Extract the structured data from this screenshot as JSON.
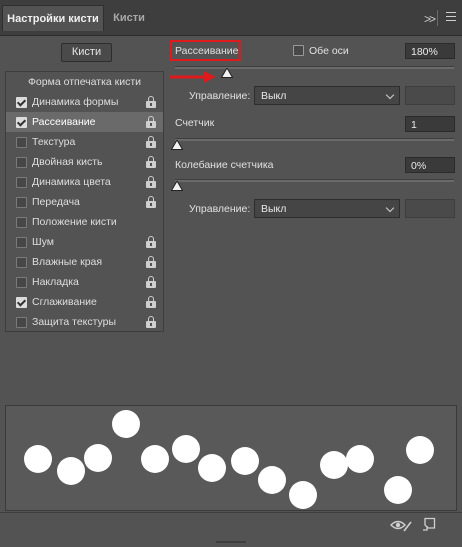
{
  "tabs": [
    {
      "label": "Настройки кисти",
      "active": true
    },
    {
      "label": "Кисти",
      "active": false
    }
  ],
  "toolbar": {
    "collapse_icon": "double-chevron-right",
    "menu_icon": "hamburger-menu"
  },
  "brushes_button": "Кисти",
  "sidebar": {
    "header": "Форма отпечатка кисти",
    "items": [
      {
        "label": "Динамика формы",
        "checked": true,
        "locked": true,
        "selected": false
      },
      {
        "label": "Рассеивание",
        "checked": true,
        "locked": true,
        "selected": true
      },
      {
        "label": "Текстура",
        "checked": false,
        "locked": true,
        "selected": false
      },
      {
        "label": "Двойная кисть",
        "checked": false,
        "locked": true,
        "selected": false
      },
      {
        "label": "Динамика цвета",
        "checked": false,
        "locked": true,
        "selected": false
      },
      {
        "label": "Передача",
        "checked": false,
        "locked": true,
        "selected": false
      },
      {
        "label": "Положение кисти",
        "checked": false,
        "locked": false,
        "selected": false
      },
      {
        "label": "Шум",
        "checked": false,
        "locked": true,
        "selected": false
      },
      {
        "label": "Влажные края",
        "checked": false,
        "locked": true,
        "selected": false
      },
      {
        "label": "Накладка",
        "checked": false,
        "locked": true,
        "selected": false
      },
      {
        "label": "Сглаживание",
        "checked": true,
        "locked": true,
        "selected": false
      },
      {
        "label": "Защита текстуры",
        "checked": false,
        "locked": true,
        "selected": false
      }
    ]
  },
  "scatter": {
    "label": "Рассеивание",
    "both_axes_label": "Обе оси",
    "both_axes_checked": false,
    "value": "180%",
    "slider_fraction": 0.18,
    "control_label": "Управление:",
    "control_value": "Выкл"
  },
  "count": {
    "label": "Счетчик",
    "value": "1",
    "slider_fraction": 0.0
  },
  "count_jitter": {
    "label": "Колебание счетчика",
    "value": "0%",
    "slider_fraction": 0.0,
    "control_label": "Управление:",
    "control_value": "Выкл"
  },
  "annotation_color": "#e0191b",
  "bottom_icons": [
    "eye-brush-icon",
    "new-preset-icon"
  ]
}
